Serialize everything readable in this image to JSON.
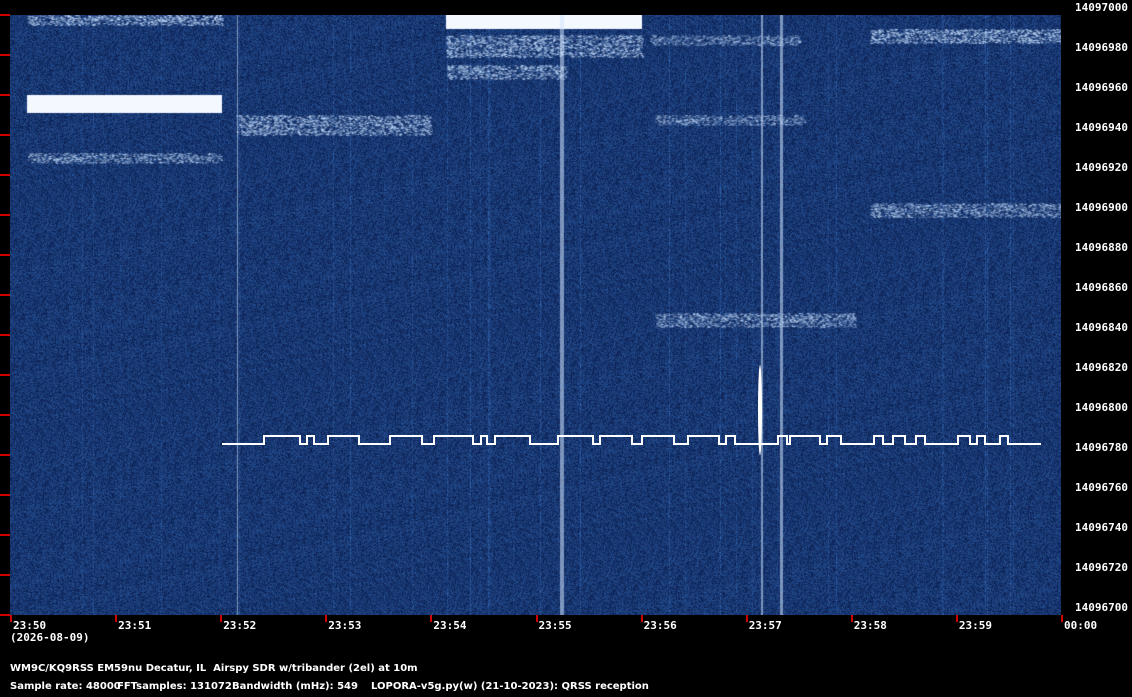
{
  "frequency_labels": [
    "14097000",
    "14096980",
    "14096960",
    "14096940",
    "14096920",
    "14096900",
    "14096880",
    "14096860",
    "14096840",
    "14096820",
    "14096800",
    "14096780",
    "14096760",
    "14096740",
    "14096720",
    "14096700"
  ],
  "time_labels": [
    "23:50",
    "23:51",
    "23:52",
    "23:53",
    "23:54",
    "23:55",
    "23:56",
    "23:57",
    "23:58",
    "23:59",
    "00:00"
  ],
  "date_label": "(2026-08-09)",
  "station_line": "WM9C/KQ9RSS EM59nu Decatur, IL  Airspy SDR w/tribander (2el) at 10m",
  "params": {
    "sample_rate": "Sample rate: 48000",
    "fft_samples": "FFTsamples: 131072",
    "bandwidth": "Bandwidth (mHz): 549",
    "software": "LOPORA-v5g.py(w) (21-10-2023): QRSS reception"
  },
  "colors": {
    "background": "#000000",
    "waterfall_base": "#0d2a5c",
    "signal": "#ffffff",
    "tick": "#d00000"
  }
}
